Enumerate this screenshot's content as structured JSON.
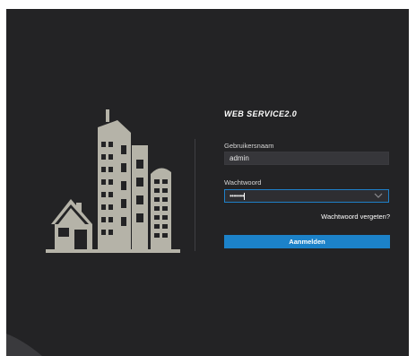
{
  "brand": {
    "title": "WEB SERVICE2.0"
  },
  "login": {
    "username_label": "Gebruikersnaam",
    "username_value": "admin",
    "password_label": "Wachtwoord",
    "password_mask": "•••••••",
    "forgot_password": "Wachtwoord vergeten?",
    "submit_label": "Aanmelden"
  },
  "colors": {
    "background": "#232325",
    "accent": "#1c82c9",
    "illustration": "#b5b3a8",
    "field": "#36363a"
  },
  "icons": {
    "illustration": "city-buildings-house-icon",
    "dropdown": "chevron-down-icon"
  }
}
